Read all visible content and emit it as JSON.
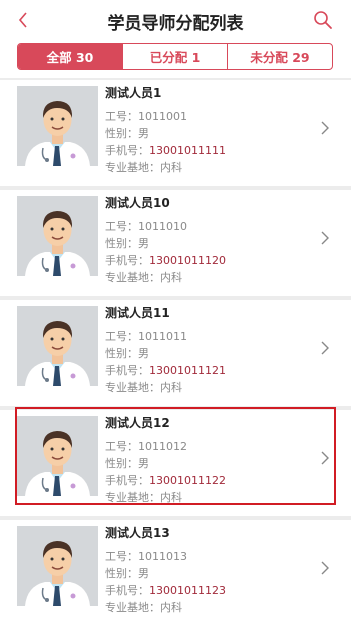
{
  "header": {
    "title": "学员导师分配列表",
    "back_icon": "chevron-left-icon",
    "search_icon": "search-icon"
  },
  "tabs": [
    {
      "label": "全部 30",
      "active": true
    },
    {
      "label": "已分配 1",
      "active": false
    },
    {
      "label": "未分配 29",
      "active": false
    }
  ],
  "labels": {
    "id": "工号：",
    "gender": "性别：",
    "phone": "手机号：",
    "base": "专业基地："
  },
  "people": [
    {
      "name": "测试人员1",
      "id": "1011001",
      "gender": "男",
      "phone": "13001011111",
      "base": "内科"
    },
    {
      "name": "测试人员10",
      "id": "1011010",
      "gender": "男",
      "phone": "13001011120",
      "base": "内科"
    },
    {
      "name": "测试人员11",
      "id": "1011011",
      "gender": "男",
      "phone": "13001011121",
      "base": "内科"
    },
    {
      "name": "测试人员12",
      "id": "1011012",
      "gender": "男",
      "phone": "13001011122",
      "base": "内科"
    },
    {
      "name": "测试人员13",
      "id": "1011013",
      "gender": "男",
      "phone": "13001011123",
      "base": "内科"
    }
  ],
  "colors": {
    "accent": "#d8495a",
    "phone": "#a12a3a",
    "highlight": "#d11c24"
  }
}
